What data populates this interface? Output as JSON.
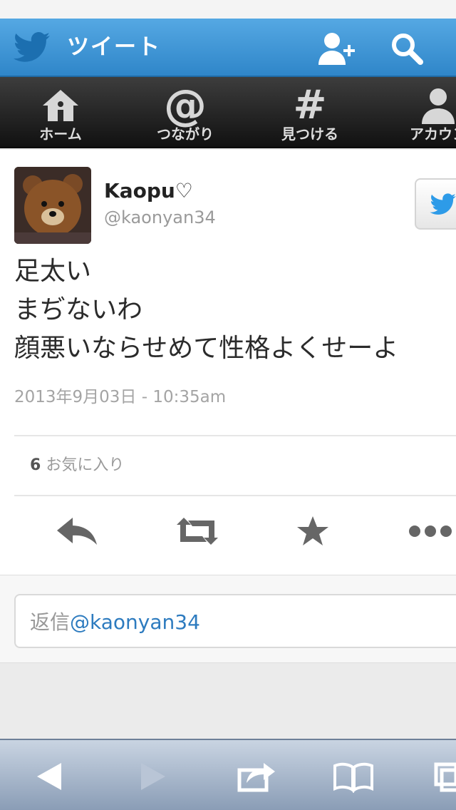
{
  "app": {
    "title": "ツイート",
    "colors": {
      "brand": "#3a94d6",
      "nav_bg": "#1b1b1b",
      "mention": "#2d7bbf"
    }
  },
  "nav": {
    "items": [
      {
        "label": "ホーム",
        "icon": "home-icon"
      },
      {
        "label": "つながり",
        "icon": "at-icon"
      },
      {
        "label": "見つける",
        "icon": "hash-icon"
      },
      {
        "label": "アカウン",
        "icon": "account-icon"
      }
    ],
    "at_glyph": "@",
    "hash_glyph": "#"
  },
  "tweet": {
    "display_name": "Kaopu♡",
    "handle": "@kaonyan34",
    "text_lines": [
      "足太い",
      "まぢないわ",
      "顔悪いならせめて性格よくせーよ"
    ],
    "timestamp": "2013年9月03日 - 10:35am",
    "favorites_count": "6",
    "favorites_label": "お気に入り"
  },
  "reply": {
    "prefix": "返信",
    "mention": "@kaonyan34"
  },
  "icons": {
    "topbar": [
      "twitter-bird-icon",
      "add-user-icon",
      "search-icon"
    ],
    "actions": [
      "reply-icon",
      "retweet-icon",
      "favorite-star-icon",
      "more-icon"
    ],
    "toolbar": [
      "back-icon",
      "forward-icon",
      "share-icon",
      "bookmarks-icon",
      "tabs-icon"
    ]
  }
}
